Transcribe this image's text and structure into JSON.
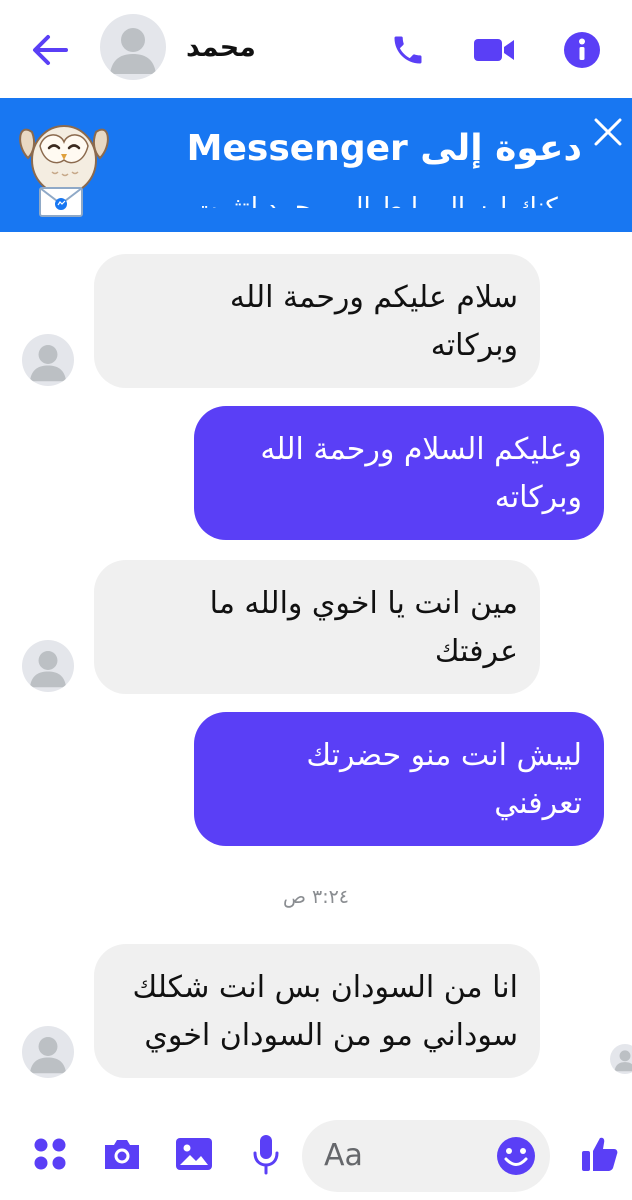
{
  "header": {
    "contact_name": "محمد"
  },
  "banner": {
    "title": "دعوة إلى Messenger",
    "subtitle": "يمكنك إرسال رابط إلى محمد لتثبيت"
  },
  "messages": [
    {
      "direction": "incoming",
      "lines": [
        "سلام عليكم ورحمة الله",
        "وبركاته"
      ]
    },
    {
      "direction": "outgoing",
      "lines": [
        "وعليكم السلام ورحمة الله",
        "وبركاته"
      ]
    },
    {
      "direction": "incoming",
      "lines": [
        "مين انت يا اخوي والله ما",
        "عرفتك"
      ]
    },
    {
      "direction": "outgoing",
      "lines": [
        "لييش انت منو حضرتك",
        "تعرفني"
      ]
    },
    {
      "direction": "incoming",
      "lines": [
        "انا من السودان بس انت شكلك",
        "سوداني مو من السودان اخوي"
      ]
    }
  ],
  "timestamp": "٣:٢٤ ص",
  "composer": {
    "placeholder": "Aa"
  },
  "colors": {
    "accent": "#5a3ff6",
    "banner": "#1877f2",
    "incoming_bubble": "#f0f0f0"
  },
  "icons": [
    "back-arrow-icon",
    "phone-icon",
    "video-camera-icon",
    "info-icon",
    "close-icon",
    "apps-grid-icon",
    "camera-icon",
    "image-icon",
    "microphone-icon",
    "emoji-icon",
    "thumbs-up-icon"
  ]
}
